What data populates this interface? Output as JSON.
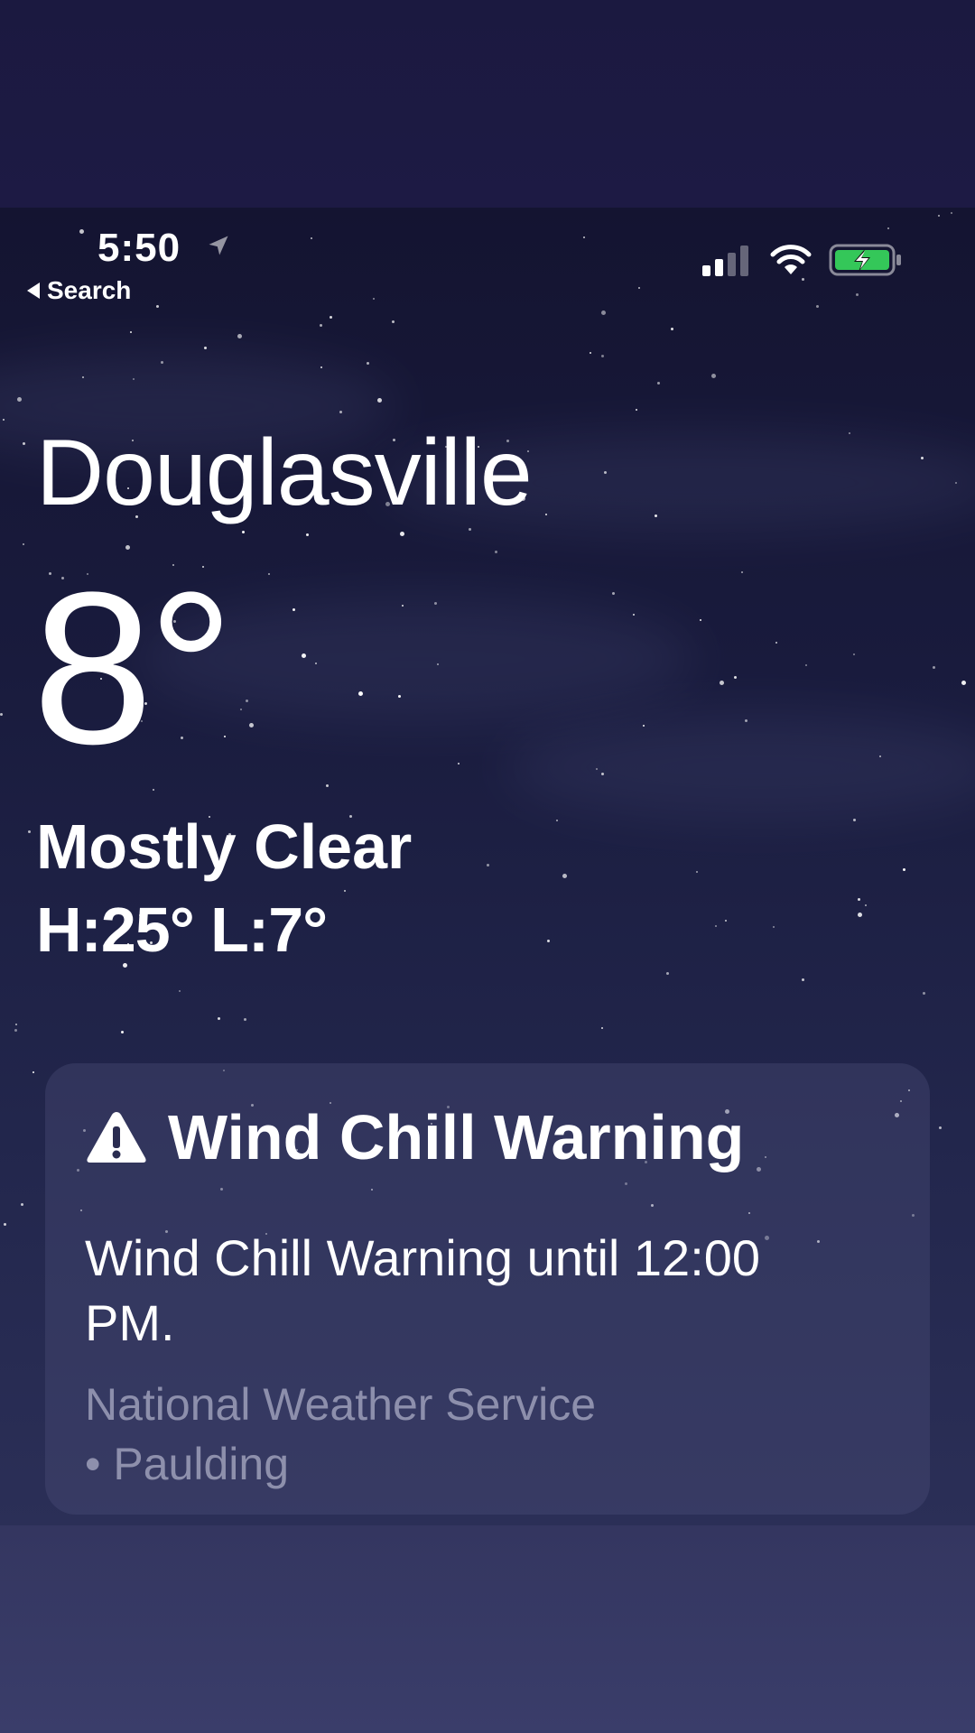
{
  "status_bar": {
    "time": "5:50",
    "back_label": "Search",
    "location_icon": "location-arrow-icon",
    "signal_icon": "cellular-signal-icon",
    "wifi_icon": "wifi-icon",
    "battery_icon": "battery-charging-icon",
    "battery_color": "#34c759",
    "signal_bars_active": 2,
    "signal_bars_total": 4
  },
  "weather": {
    "city": "Douglasville",
    "temperature": "8°",
    "condition": "Mostly Clear",
    "high_low": "H:25°  L:7°"
  },
  "alert": {
    "icon": "warning-triangle-icon",
    "title": "Wind Chill Warning",
    "body": "Wind Chill Warning until 12:00 PM.",
    "source_line1": "National Weather Service",
    "source_line2": "• Paulding"
  },
  "colors": {
    "sky_top": "#141431",
    "sky_bottom": "#2b2f57",
    "secondary_text": "#a8aac0"
  }
}
